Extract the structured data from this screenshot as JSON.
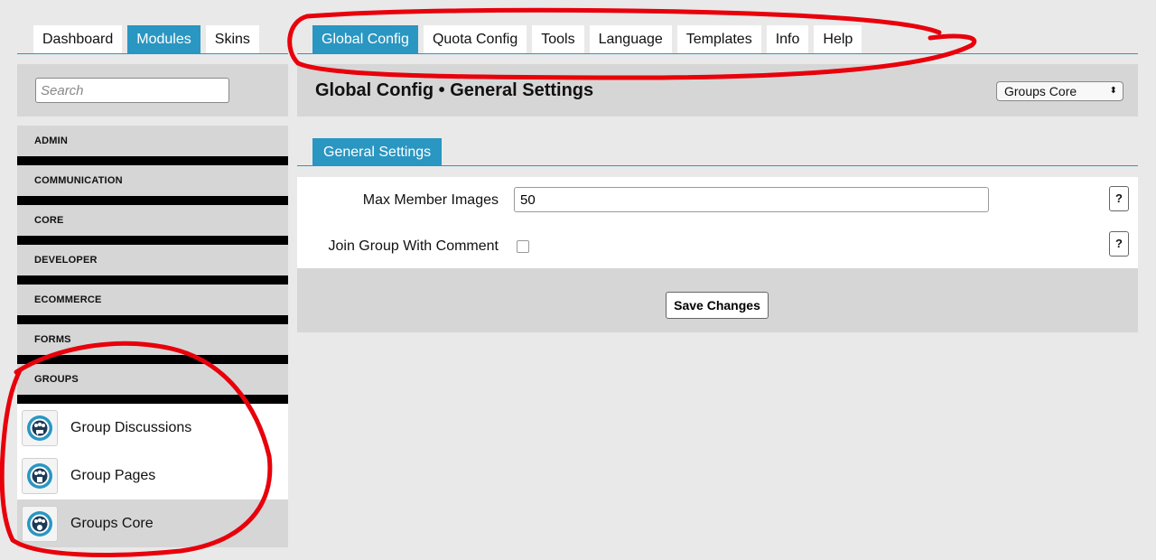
{
  "nav": {
    "primary_tabs": [
      {
        "label": "Dashboard",
        "active": false
      },
      {
        "label": "Modules",
        "active": true
      },
      {
        "label": "Skins",
        "active": false
      }
    ],
    "config_tabs": [
      {
        "label": "Global Config",
        "active": true
      },
      {
        "label": "Quota Config",
        "active": false
      },
      {
        "label": "Tools",
        "active": false
      },
      {
        "label": "Language",
        "active": false
      },
      {
        "label": "Templates",
        "active": false
      },
      {
        "label": "Info",
        "active": false
      },
      {
        "label": "Help",
        "active": false
      }
    ]
  },
  "sidebar": {
    "search_placeholder": "Search",
    "categories": [
      "ADMIN",
      "COMMUNICATION",
      "CORE",
      "DEVELOPER",
      "ECOMMERCE",
      "FORMS",
      "GROUPS"
    ],
    "modules": [
      {
        "label": "Group Discussions",
        "icon": "group-discussions-icon",
        "selected": false
      },
      {
        "label": "Group Pages",
        "icon": "group-pages-icon",
        "selected": false
      },
      {
        "label": "Groups Core",
        "icon": "groups-core-icon",
        "selected": true
      }
    ]
  },
  "main": {
    "title": "Global Config • General Settings",
    "module_select": {
      "value": "Groups Core"
    },
    "subtab": "General Settings",
    "fields": {
      "max_member_images": {
        "label": "Max Member Images",
        "value": "50"
      },
      "join_group_with_comment": {
        "label": "Join Group With Comment",
        "checked": false
      }
    },
    "help_label": "?",
    "save_label": "Save Changes"
  },
  "colors": {
    "accent": "#2a96c2",
    "panel": "#d6d6d6",
    "annotation": "#e8000b"
  }
}
